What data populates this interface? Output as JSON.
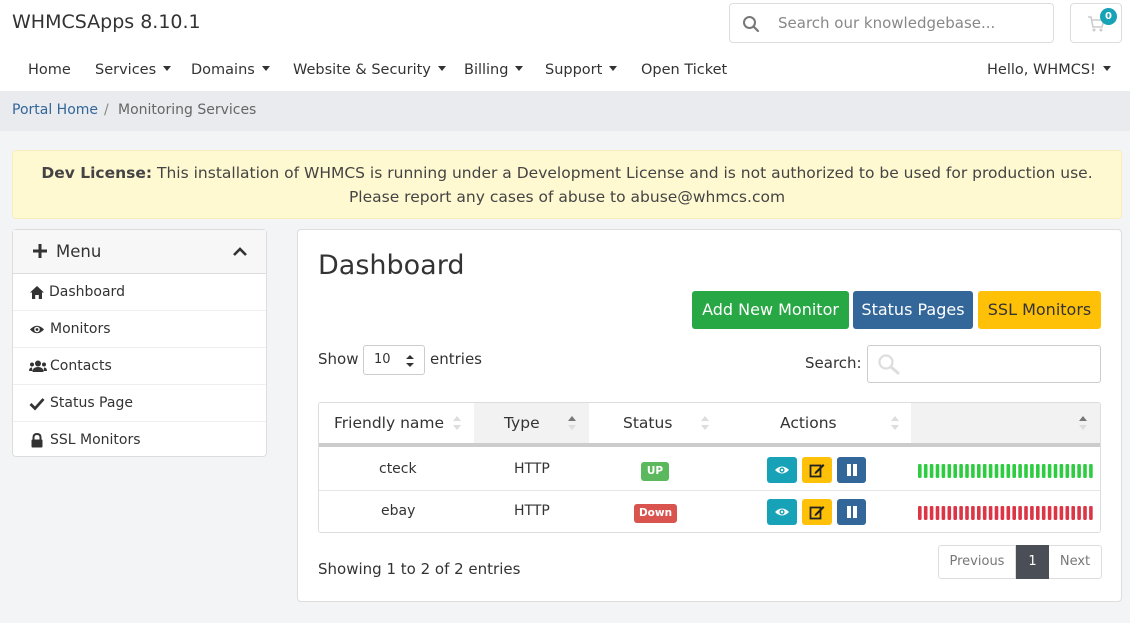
{
  "header": {
    "logo_text": "WHMCSApps 8.10.1",
    "search_placeholder": "Search our knowledgebase...",
    "cart_count": "0"
  },
  "nav": {
    "items": [
      {
        "label": "Home"
      },
      {
        "label": "Services"
      },
      {
        "label": "Domains"
      },
      {
        "label": "Website & Security"
      },
      {
        "label": "Billing"
      },
      {
        "label": "Support"
      },
      {
        "label": "Open Ticket"
      }
    ],
    "user_label": "Hello, WHMCS!"
  },
  "breadcrumb": {
    "home": "Portal Home",
    "separator": "/",
    "current": "Monitoring Services"
  },
  "alert": {
    "title": "Dev License:",
    "line1": "This installation of WHMCS is running under a Development License and is not authorized to be used for production use.",
    "line2": "Please report any cases of abuse to abuse@whmcs.com"
  },
  "sidebar": {
    "title": "Menu",
    "items": [
      {
        "label": "Dashboard",
        "icon": "home-icon"
      },
      {
        "label": "Monitors",
        "icon": "eye-icon"
      },
      {
        "label": "Contacts",
        "icon": "users-icon"
      },
      {
        "label": "Status Page",
        "icon": "check-icon"
      },
      {
        "label": "SSL Monitors",
        "icon": "lock-icon"
      }
    ]
  },
  "main": {
    "title": "Dashboard",
    "buttons": {
      "add": "Add New Monitor",
      "status_pages": "Status Pages",
      "ssl": "SSL Monitors"
    },
    "show_label": "Show",
    "entries_value": "10",
    "entries_label": "entries",
    "search_label": "Search:",
    "table": {
      "headers": [
        "Friendly name",
        "Type",
        "Status",
        "Actions",
        ""
      ],
      "rows": [
        {
          "name": "cteck",
          "type": "HTTP",
          "status": "UP",
          "uptime_state": "up"
        },
        {
          "name": "ebay",
          "type": "HTTP",
          "status": "Down",
          "uptime_state": "down"
        }
      ]
    },
    "info_text": "Showing 1 to 2 of 2 entries",
    "pagination": {
      "previous": "Previous",
      "current": "1",
      "next": "Next"
    }
  },
  "colors": {
    "primary": "#336699",
    "success": "#28a745",
    "warning": "#ffc107",
    "info": "#17a2b8",
    "danger": "#d9534f",
    "up_bar": "#2ecc40",
    "down_bar": "#dc3545"
  }
}
